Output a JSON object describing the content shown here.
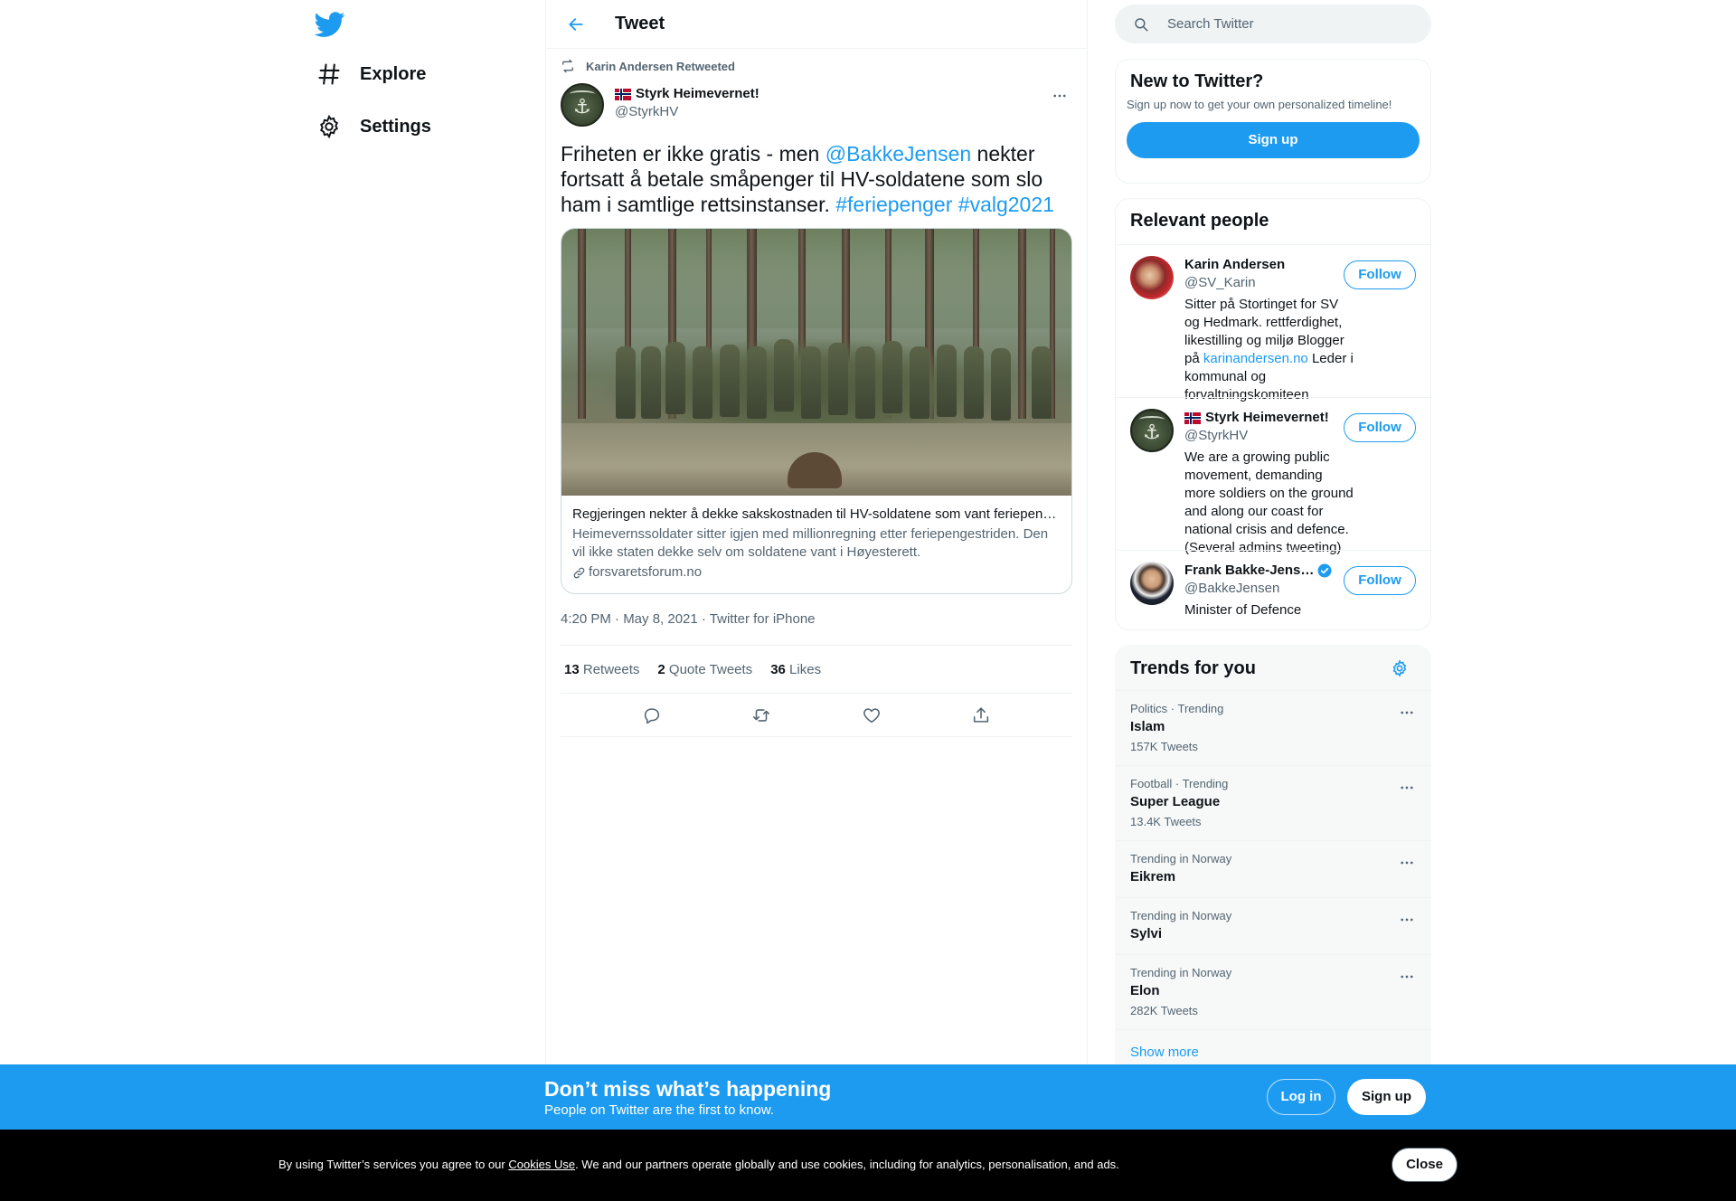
{
  "nav": {
    "explore_label": "Explore",
    "settings_label": "Settings"
  },
  "header": {
    "title": "Tweet"
  },
  "tweet": {
    "retweeted_by": "Karin Andersen Retweeted",
    "author": {
      "name": "Styrk Heimevernet!",
      "handle": "@StyrkHV",
      "flag": "Norway flag"
    },
    "text_parts": [
      {
        "t": "Friheten er ikke gratis - men ",
        "link": false
      },
      {
        "t": "@BakkeJensen",
        "link": true
      },
      {
        "t": " nekter fortsatt å betale småpenger til HV-soldatene som slo ham i samtlige rettsinstanser. ",
        "link": false
      },
      {
        "t": "#feriepenger",
        "link": true
      },
      {
        "t": " ",
        "link": false
      },
      {
        "t": "#valg2021",
        "link": true
      }
    ],
    "card": {
      "title": "Regjeringen nekter å dekke sakskostnaden til HV-soldatene som vant feriepengesaken",
      "description": "Heimevernssoldater sitter igjen med millionregning etter feriepengestriden. Den vil ikke staten dekke selv om soldatene vant i Høyesterett.",
      "domain": "forsvaretsforum.no"
    },
    "meta": "4:20 PM · May 8, 2021 · Twitter for iPhone",
    "stats": {
      "retweets_count": "13",
      "retweets_label": "Retweets",
      "quotes_count": "2",
      "quotes_label": "Quote Tweets",
      "likes_count": "36",
      "likes_label": "Likes"
    }
  },
  "search": {
    "placeholder": "Search Twitter"
  },
  "new_to_twitter": {
    "title": "New to Twitter?",
    "subtitle": "Sign up now to get your own personalized timeline!",
    "button": "Sign up"
  },
  "relevant_people": {
    "title": "Relevant people",
    "people": [
      {
        "name": "Karin Andersen",
        "handle": "@SV_Karin",
        "bio_pre": "Sitter på Stortinget for SV og Hedmark. rettferdighet, likestilling og miljø Blogger på ",
        "bio_link": "karinandersen.no",
        "bio_post": " Leder i kommunal og forvaltningskomiteen",
        "follow": "Follow"
      },
      {
        "name": "Styrk Heimevernet!",
        "handle": "@StyrkHV",
        "bio": "We are a growing public movement, demanding more soldiers on the ground and along our coast for national crisis and defence. (Several admins tweeting)",
        "follow": "Follow"
      },
      {
        "name": "Frank Bakke-Jens…",
        "handle": "@BakkeJensen",
        "bio": "Minister of Defence",
        "follow": "Follow",
        "verified": true
      }
    ]
  },
  "trends": {
    "title": "Trends for you",
    "items": [
      {
        "meta": "Politics · Trending",
        "name": "Islam",
        "count": "157K Tweets"
      },
      {
        "meta": "Football · Trending",
        "name": "Super League",
        "count": "13.4K Tweets"
      },
      {
        "meta": "Trending in Norway",
        "name": "Eikrem",
        "count": ""
      },
      {
        "meta": "Trending in Norway",
        "name": "Sylvi",
        "count": ""
      },
      {
        "meta": "Trending in Norway",
        "name": "Elon",
        "count": "282K Tweets"
      }
    ],
    "show_more": "Show more"
  },
  "bottom_bar": {
    "title": "Don’t miss what’s happening",
    "subtitle": "People on Twitter are the first to know.",
    "login": "Log in",
    "signup": "Sign up"
  },
  "cookie_bar": {
    "text_pre": "By using Twitter’s services you agree to our ",
    "link": "Cookies Use",
    "text_post": ". We and our partners operate globally and use cookies, including for analytics, personalisation, and ads.",
    "close": "Close"
  },
  "colors": {
    "accent": "#1d9bf0",
    "text": "#0f1419",
    "secondary": "#536471",
    "cookie_bg": "#000000"
  }
}
